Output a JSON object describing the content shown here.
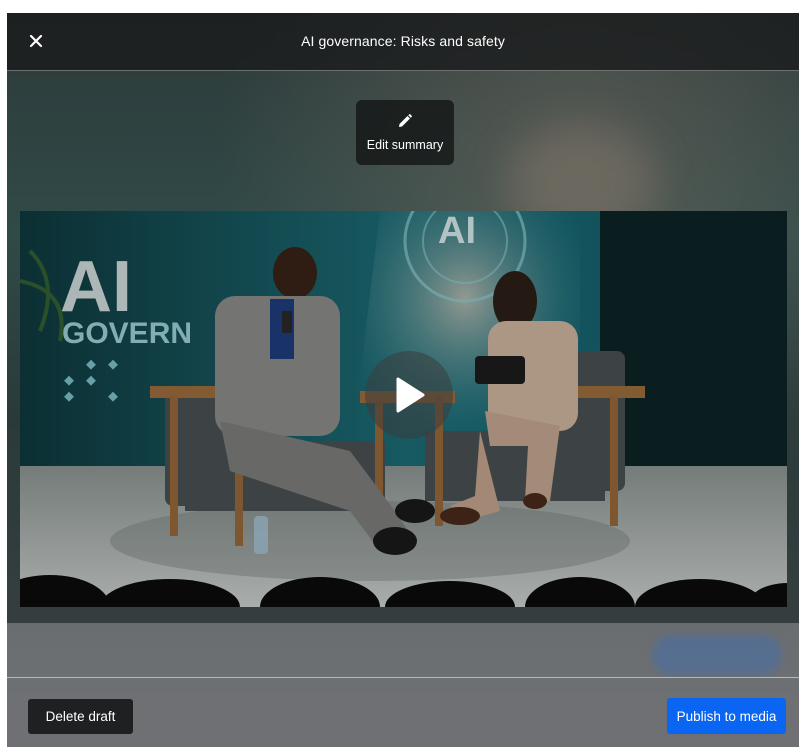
{
  "header": {
    "title": "AI governance: Risks and safety",
    "close_icon": "close-icon"
  },
  "edit_summary": {
    "label": "Edit summary",
    "icon": "pencil-icon"
  },
  "video": {
    "play_icon": "play-icon",
    "backdrop_text_line1": "AI",
    "backdrop_text_line2": "GOVERN",
    "screen_logo": "AI"
  },
  "footer": {
    "delete_label": "Delete draft",
    "publish_label": "Publish to media"
  },
  "colors": {
    "publish_accent": "#0a66f2",
    "delete_bg": "#1f2021",
    "stage_teal": "#1f8a98"
  }
}
